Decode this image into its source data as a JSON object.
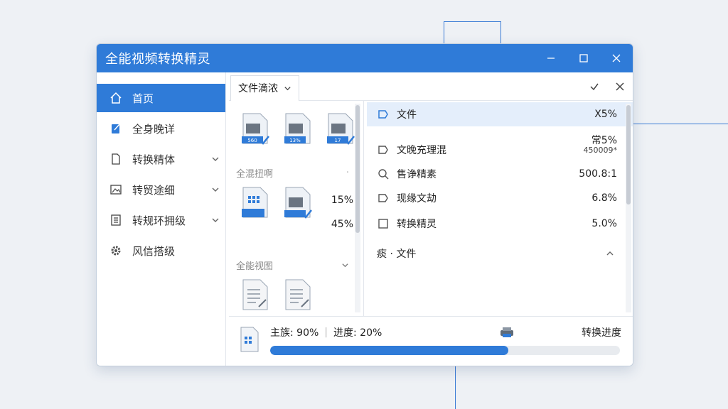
{
  "window": {
    "title": "全能视频转换精灵"
  },
  "sidebar": {
    "items": [
      {
        "label": "首页",
        "icon": "home-icon",
        "active": true,
        "expandable": false
      },
      {
        "label": "全身晚详",
        "icon": "edit-doc-icon",
        "active": false,
        "expandable": false
      },
      {
        "label": "转换精体",
        "icon": "document-icon",
        "active": false,
        "expandable": true
      },
      {
        "label": "转贸途细",
        "icon": "image-icon",
        "active": false,
        "expandable": true
      },
      {
        "label": "转规环拥级",
        "icon": "list-doc-icon",
        "active": false,
        "expandable": true
      },
      {
        "label": "风信搭级",
        "icon": "gear-icon",
        "active": false,
        "expandable": false
      }
    ]
  },
  "toolbar": {
    "dropdown_label": "文件滴浓"
  },
  "left_pane": {
    "top_files": [
      "560",
      "13%",
      "17"
    ],
    "section1": "全混扭啊",
    "mid_percents": [
      "15%",
      "45%"
    ],
    "section2": "全能视图"
  },
  "right_pane": {
    "rows": [
      {
        "name": "文件",
        "value": "X5%",
        "selected": true
      },
      {
        "name": "文晚充理混",
        "value": "常5%",
        "value2": "450009*"
      },
      {
        "name": "售诤精素",
        "value": "500.8:1"
      },
      {
        "name": "现缘文劫",
        "value": "6.8%"
      },
      {
        "name": "转换精灵",
        "value": "5.0%"
      }
    ],
    "group_label": "痰 · 文件"
  },
  "status": {
    "main_label": "主族: 90%",
    "progress_label": "进度: 20%",
    "right_label": "转换进度",
    "progress": 0.68
  },
  "colors": {
    "accent": "#2f7bd8",
    "selected_row": "#e4eefb"
  }
}
